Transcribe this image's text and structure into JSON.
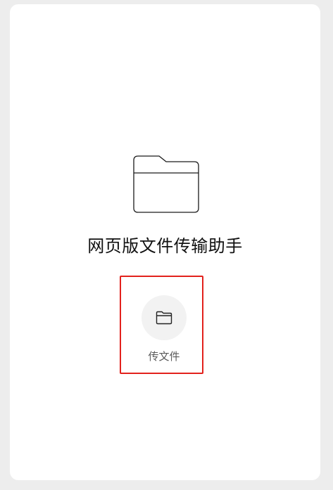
{
  "app": {
    "title": "网页版文件传输助手"
  },
  "actions": {
    "send_file": {
      "label": "传文件",
      "icon": "folder-icon"
    }
  },
  "icons": {
    "hero": "folder-icon"
  },
  "colors": {
    "background": "#ededed",
    "card": "#ffffff",
    "highlight_border": "#e2211c",
    "button_circle": "#f2f2f2",
    "title_text": "#111111",
    "label_text": "#5a5a5a"
  }
}
